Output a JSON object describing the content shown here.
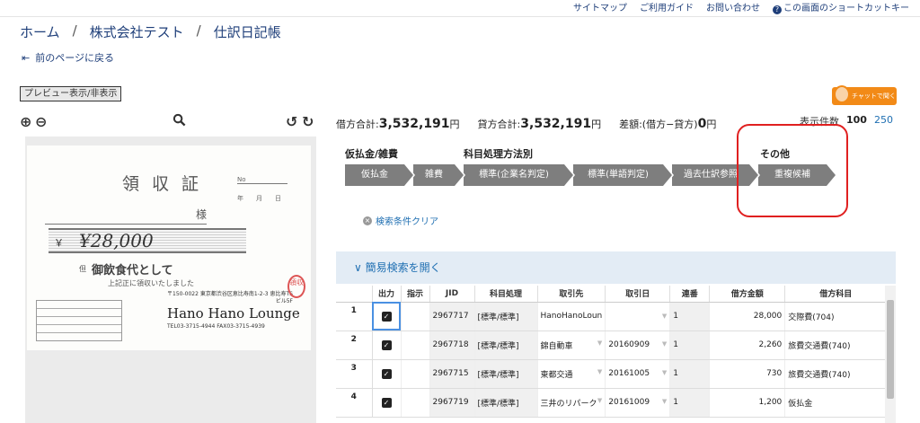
{
  "topnav": {
    "sitemap": "サイトマップ",
    "guide": "ご利用ガイド",
    "contact": "お問い合わせ",
    "shortcut": "この画面のショートカットキー"
  },
  "breadcrumb": {
    "home": "ホーム",
    "company": "株式会社テスト",
    "page": "仕訳日記帳"
  },
  "back_label": "前のページに戻る",
  "preview_toggle": "プレビュー表示/非表示",
  "chat_label": "チャットで聞く",
  "receipt": {
    "title": "領収証",
    "no_label": "No",
    "date_label": "年月日",
    "sama": "様",
    "yen": "￥",
    "amount": "¥28,000",
    "tadashi": "但",
    "purpose": "御飲食代として",
    "received": "上記正に領収いたしました",
    "address": "〒150-0022 東京都渋谷区恵比寿南1-2-3 恵比寿TSビル5F",
    "shop": "Hano Hano Lounge",
    "tel": "TEL03-3715-4944 FAX03-3715-4939",
    "stamp": "領収"
  },
  "totals": {
    "debit_label": "借方合計:",
    "debit_value": "3,532,191",
    "credit_label": "貸方合計:",
    "credit_value": "3,532,191",
    "yen": "円",
    "diff_label": "差額:(借方−貸方)",
    "diff_value": "0"
  },
  "display_count": {
    "label": "表示件数",
    "current": "100",
    "alt": "250"
  },
  "filter_groups": {
    "group1": "仮払金/雑費",
    "group2": "科目処理方法別",
    "group3": "その他"
  },
  "chips": {
    "karibarai": "仮払金",
    "zappi": "雑費",
    "std_company": "標準(企業名判定)",
    "std_word": "標準(単語判定)",
    "past_ref": "過去仕訳参照",
    "dup": "重複候補"
  },
  "clear_search": "検索条件クリア",
  "simple_search": "簡易検索を開く",
  "table": {
    "headers": [
      "",
      "出力",
      "指示",
      "JID",
      "科目処理",
      "取引先",
      "取引日",
      "連番",
      "借方金額",
      "借方科目"
    ],
    "rows": [
      {
        "no": "1",
        "jid": "2967717",
        "proc": "[標準/標準]",
        "partner": "HanoHanoLoun",
        "date": "",
        "seq": "1",
        "amount": "28,000",
        "account": "交際費(704)"
      },
      {
        "no": "2",
        "jid": "2967718",
        "proc": "[標準/標準]",
        "partner": "錦自動車",
        "date": "20160909",
        "seq": "1",
        "amount": "2,260",
        "account": "旅費交通費(740)"
      },
      {
        "no": "3",
        "jid": "2967715",
        "proc": "[標準/標準]",
        "partner": "東都交通",
        "date": "20161005",
        "seq": "1",
        "amount": "730",
        "account": "旅費交通費(740)"
      },
      {
        "no": "4",
        "jid": "2967719",
        "proc": "[標準/標準]",
        "partner": "三井のリパーク",
        "date": "20161009",
        "seq": "1",
        "amount": "1,200",
        "account": "仮払金"
      }
    ]
  }
}
